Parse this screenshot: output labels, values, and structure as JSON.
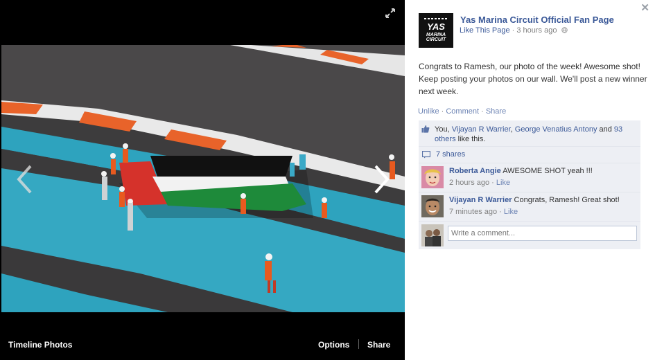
{
  "stage": {
    "album_label": "Timeline Photos",
    "options_label": "Options",
    "share_label": "Share"
  },
  "page": {
    "name": "Yas Marina Circuit Official Fan Page",
    "logo_text_1": "YAS",
    "logo_text_2": "MARINA",
    "logo_text_3": "CIRCUIT"
  },
  "post": {
    "like_page_label": "Like This Page",
    "separator": " · ",
    "time": "3 hours ago",
    "text": "Congrats to Ramesh, our photo of the week! Awesome shot! Keep posting your photos on our wall. We'll post a new winner next week.",
    "actions": {
      "unlike": "Unlike",
      "comment": "Comment",
      "share": "Share",
      "dot": " · "
    }
  },
  "likes": {
    "you": "You, ",
    "person1": "Vijayan R Warrier",
    "comma": ", ",
    "person2": "George Venatius Antony",
    "and": " and ",
    "others": "93 others",
    "suffix": " like this."
  },
  "shares": {
    "label": "7 shares"
  },
  "comments": [
    {
      "author": "Roberta Angie",
      "text": " AWESOME SHOT yeah !!!",
      "time": "2 hours ago",
      "like_label": "Like"
    },
    {
      "author": "Vijayan R Warrier",
      "text": " Congrats, Ramesh! Great shot!",
      "time": "7 minutes ago",
      "like_label": "Like"
    }
  ],
  "composer": {
    "placeholder": "Write a comment..."
  },
  "colors": {
    "link": "#3b5998",
    "ufi_background": "#edeff4",
    "track_blue": "#2ea3be",
    "kerb_orange": "#e8632a",
    "flag_green": "#1e8a3a",
    "flag_red": "#d5322b"
  }
}
